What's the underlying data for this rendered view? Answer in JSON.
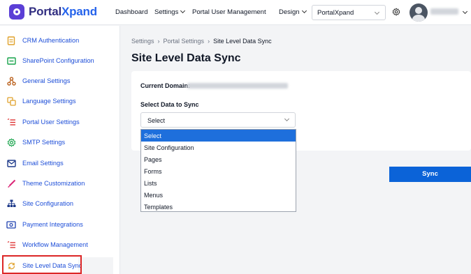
{
  "header": {
    "logo_text": "PortalXpand",
    "nav": {
      "dashboard": "Dashboard",
      "settings": "Settings",
      "portal_user_management": "Portal User Management",
      "design": "Design"
    },
    "site_select": "PortalXpand",
    "icons": [
      "gear-icon",
      "avatar",
      "chevron-down-icon"
    ]
  },
  "sidebar": {
    "items": [
      {
        "label": "CRM Authentication",
        "icon": "document-icon"
      },
      {
        "label": "SharePoint Configuration",
        "icon": "panel-icon"
      },
      {
        "label": "General Settings",
        "icon": "nodes-icon"
      },
      {
        "label": "Language Settings",
        "icon": "translate-icon"
      },
      {
        "label": "Portal User Settings",
        "icon": "list-icon"
      },
      {
        "label": "SMTP Settings",
        "icon": "gear-icon"
      },
      {
        "label": "Email Settings",
        "icon": "mail-icon"
      },
      {
        "label": "Theme Customization",
        "icon": "brush-icon"
      },
      {
        "label": "Site Configuration",
        "icon": "sitemap-icon"
      },
      {
        "label": "Payment Integrations",
        "icon": "payment-icon"
      },
      {
        "label": "Workflow Management",
        "icon": "list-icon"
      },
      {
        "label": "Site Level Data Sync",
        "icon": "sync-icon"
      }
    ],
    "active_index": 11
  },
  "main": {
    "breadcrumb": [
      "Settings",
      "Portal Settings",
      "Site Level Data Sync"
    ],
    "title": "Site Level Data Sync",
    "current_domain_label": "Current Domain:",
    "select_data_label": "Select Data to Sync",
    "select_value": "Select",
    "options": [
      "Select",
      "Site Configuration",
      "Pages",
      "Forms",
      "Lists",
      "Menus",
      "Templates"
    ],
    "selected_option": "Select",
    "sync_button": "Sync"
  },
  "colors": {
    "brand_purple": "#5b3fd6",
    "link_blue": "#1d4ed8",
    "button_blue": "#0b63d8",
    "highlight_red": "#dc2626"
  }
}
